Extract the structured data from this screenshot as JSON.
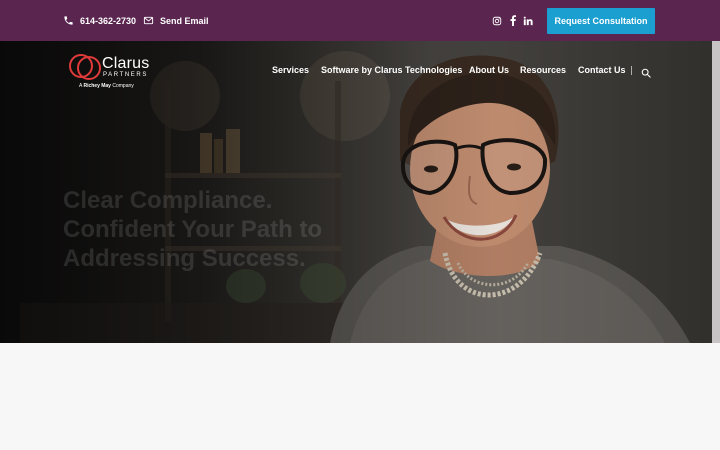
{
  "topbar": {
    "phone": "614-362-2730",
    "email_label": "Send Email",
    "social": [
      "instagram-icon",
      "facebook-icon",
      "linkedin-icon"
    ],
    "cta_label": "Request Consultation",
    "background": "#5a2650",
    "cta_color": "#1a9fd0"
  },
  "brand": {
    "name": "Clarus",
    "sub": "PARTNERS",
    "tag_prefix": "A",
    "tag_bold": "Richey May",
    "tag_suffix": "Company",
    "accent": "#e03a3a"
  },
  "nav": {
    "items": [
      "Services",
      "Software by Clarus Technologies",
      "About Us",
      "Resources",
      "Contact Us"
    ],
    "separator": "|"
  },
  "hero": {
    "headline": "Clear Compliance. Confident Your Path to Addressing Success.",
    "subtext": ""
  }
}
